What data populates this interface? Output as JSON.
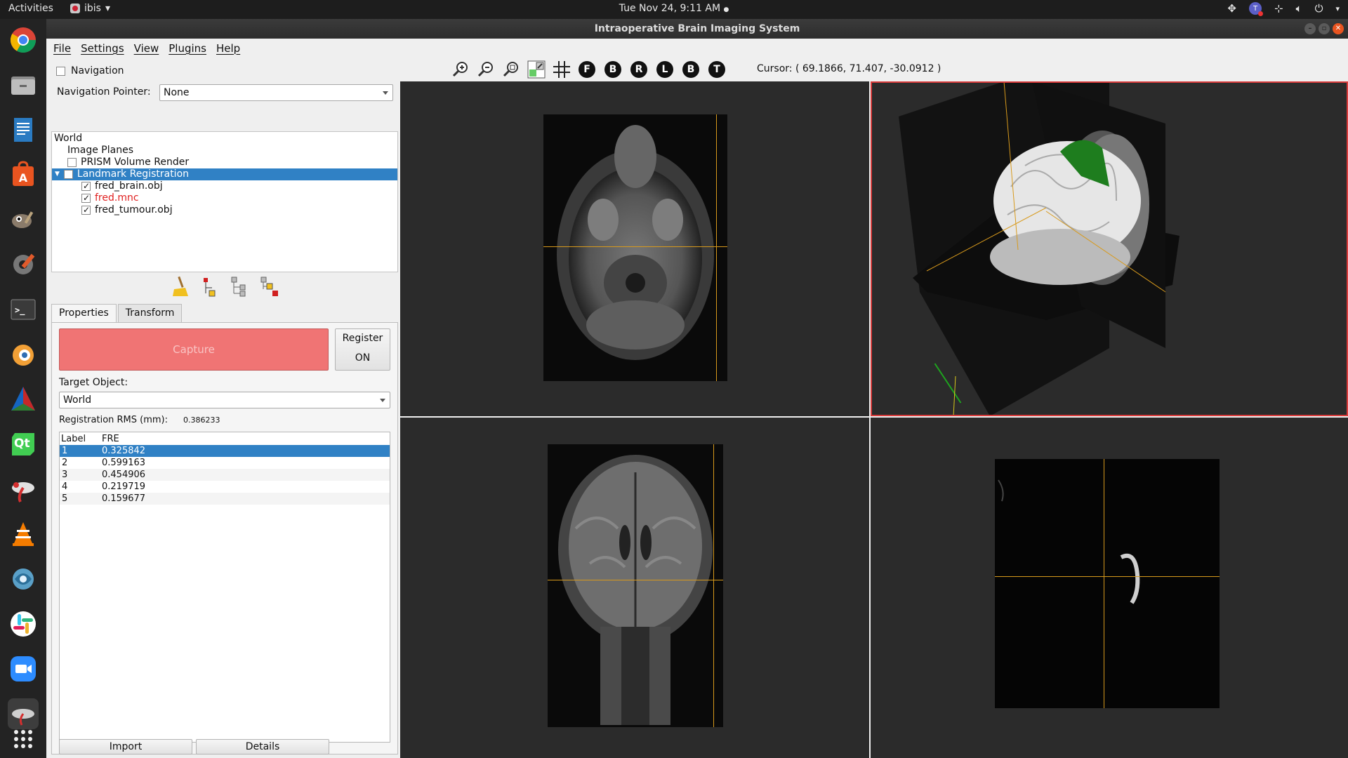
{
  "topbar": {
    "activities": "Activities",
    "app_name": "ibis",
    "clock": "Tue Nov 24,  9:11 AM",
    "tray_badge": "T"
  },
  "dock": {
    "items": [
      "chrome-icon",
      "files-icon",
      "writer-icon",
      "software-center-icon",
      "gimp-icon",
      "settings-icon",
      "terminal-icon",
      "blender-icon",
      "cmake-icon",
      "qt-icon",
      "ibis-icon",
      "vlc-icon",
      "itk-snap-icon",
      "slack-icon",
      "zoom-icon",
      "ibis-active-icon",
      "app-grid-icon"
    ],
    "qt_label": "Qt"
  },
  "window": {
    "title": "Intraoperative Brain Imaging System"
  },
  "menubar": {
    "items": [
      "File",
      "Settings",
      "View",
      "Plugins",
      "Help"
    ]
  },
  "left": {
    "navigation_label": "Navigation",
    "nav_pointer_label": "Navigation Pointer:",
    "nav_pointer_value": "None",
    "tree": {
      "world": "World",
      "image_planes": "Image Planes",
      "prism": "PRISM Volume Render",
      "landmark": "Landmark Registration",
      "brain": "fred_brain.obj",
      "mnc": "fred.mnc",
      "tumour": "fred_tumour.obj"
    },
    "tabs": [
      "Properties",
      "Transform"
    ],
    "capture": "Capture",
    "register_line1": "Register",
    "register_line2": "ON",
    "target_label": "Target Object:",
    "target_value": "World",
    "rms_label": "Registration RMS (mm):",
    "rms_value": "0.386233",
    "table": {
      "headers": [
        "Label",
        "FRE"
      ],
      "rows": [
        {
          "label": "1",
          "fre": "0.325842"
        },
        {
          "label": "2",
          "fre": "0.599163"
        },
        {
          "label": "3",
          "fre": "0.454906"
        },
        {
          "label": "4",
          "fre": "0.219719"
        },
        {
          "label": "5",
          "fre": "0.159677"
        }
      ]
    },
    "import": "Import",
    "details": "Details"
  },
  "toolbar": {
    "view_buttons": [
      "F",
      "B",
      "R",
      "L",
      "B",
      "T"
    ],
    "cursor": "Cursor: ( 69.1866, 71.407, -30.0912 )"
  },
  "colors": {
    "accent": "#3081c5",
    "capture_red": "#f07474",
    "crosshair": "#d89a1c",
    "active_view_border": "#d83b3b",
    "tumour_green": "#1e7d1e"
  }
}
